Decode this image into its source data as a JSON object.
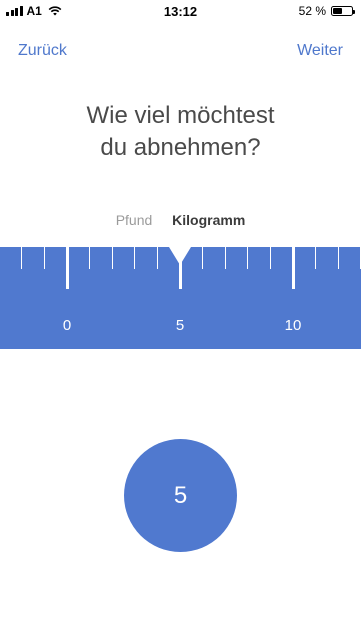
{
  "status_bar": {
    "carrier": "A1",
    "time": "13:12",
    "battery_percent": "52 %",
    "battery_level": 0.52,
    "icons": [
      "signal-icon",
      "wifi-icon",
      "battery-icon"
    ]
  },
  "nav": {
    "back_label": "Zurück",
    "next_label": "Weiter"
  },
  "question": {
    "line1": "Wie viel möchtest",
    "line2": "du abnehmen?"
  },
  "units": {
    "options": [
      "Pfund",
      "Kilogramm"
    ],
    "selected": "Kilogramm"
  },
  "ruler": {
    "labels": [
      "0",
      "5",
      "10"
    ],
    "selected_value": 5
  },
  "selected_value_display": "5",
  "colors": {
    "accent": "#4f78cc",
    "ruler_bg": "#5079cf",
    "text_dark": "#4a4a4a",
    "text_muted": "#9b9b9b"
  }
}
